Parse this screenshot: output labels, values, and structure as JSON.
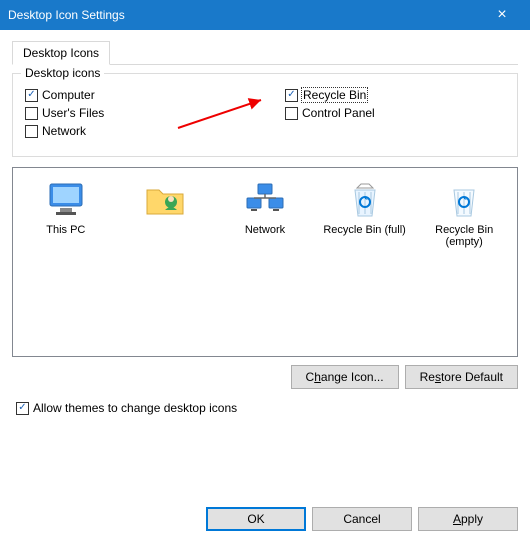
{
  "titlebar": {
    "title": "Desktop Icon Settings"
  },
  "tabs": {
    "main": "Desktop Icons"
  },
  "group": {
    "legend": "Desktop icons",
    "computer": {
      "label": "Computer",
      "checked": true
    },
    "usersfiles": {
      "label": "User's Files",
      "checked": false
    },
    "network": {
      "label": "Network",
      "checked": false
    },
    "recyclebin": {
      "label": "Recycle Bin",
      "checked": true
    },
    "controlpanel": {
      "label": "Control Panel",
      "checked": false
    }
  },
  "icons": {
    "thispc": "This PC",
    "user": "",
    "network": "Network",
    "recyclefull": "Recycle Bin (full)",
    "recycleempty": "Recycle Bin (empty)"
  },
  "buttons": {
    "changeicon": "Change Icon...",
    "restore": "Restore Default",
    "ok": "OK",
    "cancel": "Cancel",
    "apply": "Apply"
  },
  "allow": {
    "label": "Allow themes to change desktop icons",
    "checked": true
  }
}
